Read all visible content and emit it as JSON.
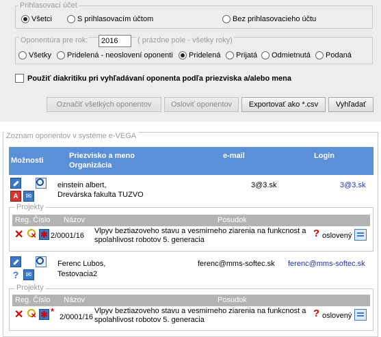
{
  "account_group": {
    "legend": "Prihlasovací účet",
    "options": [
      "Všetci",
      "S prihlasovacím účtom",
      "Bez prihlasovacieho účtu"
    ],
    "selected": "Všetci"
  },
  "year_group": {
    "legend": "Oponentúra pre rok:",
    "year_value": "2016",
    "year_hint": "( prázdne pole - všetky roky)",
    "statuses": [
      "Všetky",
      "Pridelená - neoslovení oponenti",
      "Pridelená",
      "Prijatá",
      "Odmietnutá",
      "Podaná"
    ],
    "selected_status": "Pridelená"
  },
  "diacritics_label": "Použiť diakritiku pri vyhľadávaní oponenta podľa priezviska a/alebo mena",
  "buttons": {
    "mark_all": "Označiť všetkých oponentov",
    "contact": "Osloviť oponentov",
    "export": "Exportovať ako *.csv",
    "search": "Vyhľadať"
  },
  "list": {
    "legend": "Zoznam oponentov v systéme e-VEGA",
    "headers": {
      "options": "Možnosti",
      "name": "Priezvisko a meno",
      "org": "Organizácia",
      "email": "e-mail",
      "login": "Login"
    },
    "project_legend": "Projekty",
    "project_headers": {
      "reg": "Reg. Číslo",
      "title": "Názov",
      "review": "Posudok"
    },
    "rows": [
      {
        "name": "einstein albert,",
        "org": "Drevárska fakulta TUZVO",
        "email": "3@3.sk",
        "login": "3@3.sk",
        "project": {
          "reg": "2/0001/16",
          "title_line1": "Vlpyv beztiazoveho stavu a vesmirneho ziarenia na funkcnost a",
          "title_line2": "spolahlivost robotov 5. generacia",
          "status": "oslovený"
        }
      },
      {
        "name": "Ferenc Lubos,",
        "org": "Testovacia2",
        "email": "ferenc@mms-softec.sk",
        "login": "ferenc@mms-softec.sk",
        "project": {
          "reg": "2/0001/16",
          "title_line1": "Vlpyv beztiazoveho stavu a vesmirneho ziarenia na funkcnost a",
          "title_line2": "spolahlivost robotov 5. generacia",
          "status": "oslovený",
          "star_marker": "*"
        }
      }
    ]
  },
  "colors": {
    "header_blue": "#5b8fd8",
    "panel_gray": "#ededed",
    "link_blue": "#1a2fb8",
    "delete_red": "#d00000"
  }
}
